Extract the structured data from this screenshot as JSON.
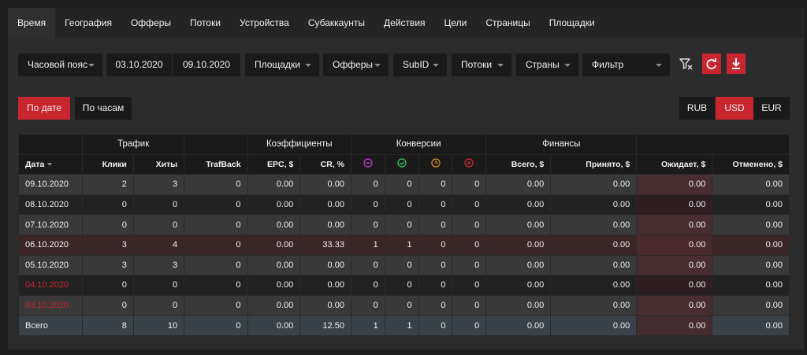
{
  "tabs": [
    "Время",
    "География",
    "Офферы",
    "Потоки",
    "Устройства",
    "Субаккаунты",
    "Действия",
    "Цели",
    "Страницы",
    "Площадки"
  ],
  "filters": {
    "timezone": "Часовой пояс",
    "date_from": "03.10.2020",
    "date_to": "09.10.2020",
    "platforms": "Площадки",
    "offers": "Офферы",
    "subid": "SubID",
    "streams": "Потоки",
    "countries": "Страны",
    "filter": "Фильтр"
  },
  "icons": {
    "filter_clear": "filter-clear-icon",
    "refresh": "refresh-icon",
    "download": "download-icon"
  },
  "grouping": {
    "by_date": "По дате",
    "by_hour": "По часам"
  },
  "currency": {
    "rub": "RUB",
    "usd": "USD",
    "eur": "EUR",
    "selected": "USD"
  },
  "table": {
    "groups": {
      "traffic": "Трафик",
      "ratios": "Коэффициенты",
      "conversions": "Конверсии",
      "finance": "Финансы"
    },
    "columns": {
      "date": "Дата",
      "clicks": "Клики",
      "hits": "Хиты",
      "trafback": "TrafBack",
      "epc": "EPC, $",
      "cr": "CR, %",
      "total": "Всего, $",
      "accepted": "Принято, $",
      "pending": "Ожидает, $",
      "cancelled": "Отменено, $"
    },
    "conversion_icons": [
      {
        "name": "pending-conversion-icon",
        "color": "#c13bd0"
      },
      {
        "name": "approved-conversion-icon",
        "color": "#3fc45a"
      },
      {
        "name": "hold-conversion-icon",
        "color": "#e08a1e"
      },
      {
        "name": "rejected-conversion-icon",
        "color": "#c8252f"
      }
    ],
    "rows": [
      {
        "date": "09.10.2020",
        "weekend": false,
        "clicks": "2",
        "hits": "3",
        "trafback": "0",
        "epc": "0.00",
        "cr": "0.00",
        "c1": "0",
        "c2": "0",
        "c3": "0",
        "c4": "0",
        "total": "0.00",
        "accepted": "0.00",
        "pending": "0.00",
        "cancelled": "0.00"
      },
      {
        "date": "08.10.2020",
        "weekend": false,
        "clicks": "0",
        "hits": "0",
        "trafback": "0",
        "epc": "0.00",
        "cr": "0.00",
        "c1": "0",
        "c2": "0",
        "c3": "0",
        "c4": "0",
        "total": "0.00",
        "accepted": "0.00",
        "pending": "0.00",
        "cancelled": "0.00"
      },
      {
        "date": "07.10.2020",
        "weekend": false,
        "clicks": "0",
        "hits": "0",
        "trafback": "0",
        "epc": "0.00",
        "cr": "0.00",
        "c1": "0",
        "c2": "0",
        "c3": "0",
        "c4": "0",
        "total": "0.00",
        "accepted": "0.00",
        "pending": "0.00",
        "cancelled": "0.00"
      },
      {
        "date": "06.10.2020",
        "weekend": false,
        "highlight": true,
        "clicks": "3",
        "hits": "4",
        "trafback": "0",
        "epc": "0.00",
        "cr": "33.33",
        "c1": "1",
        "c2": "1",
        "c3": "0",
        "c4": "0",
        "total": "0.00",
        "accepted": "0.00",
        "pending": "0.00",
        "cancelled": "0.00"
      },
      {
        "date": "05.10.2020",
        "weekend": false,
        "clicks": "3",
        "hits": "3",
        "trafback": "0",
        "epc": "0.00",
        "cr": "0.00",
        "c1": "0",
        "c2": "0",
        "c3": "0",
        "c4": "0",
        "total": "0.00",
        "accepted": "0.00",
        "pending": "0.00",
        "cancelled": "0.00"
      },
      {
        "date": "04.10.2020",
        "weekend": true,
        "clicks": "0",
        "hits": "0",
        "trafback": "0",
        "epc": "0.00",
        "cr": "0.00",
        "c1": "0",
        "c2": "0",
        "c3": "0",
        "c4": "0",
        "total": "0.00",
        "accepted": "0.00",
        "pending": "0.00",
        "cancelled": "0.00"
      },
      {
        "date": "03.10.2020",
        "weekend": true,
        "clicks": "0",
        "hits": "0",
        "trafback": "0",
        "epc": "0.00",
        "cr": "0.00",
        "c1": "0",
        "c2": "0",
        "c3": "0",
        "c4": "0",
        "total": "0.00",
        "accepted": "0.00",
        "pending": "0.00",
        "cancelled": "0.00"
      }
    ],
    "totals": {
      "date": "Всего",
      "clicks": "8",
      "hits": "10",
      "trafback": "0",
      "epc": "0.00",
      "cr": "12.50",
      "c1": "1",
      "c2": "1",
      "c3": "0",
      "c4": "0",
      "total": "0.00",
      "accepted": "0.00",
      "pending": "0.00",
      "cancelled": "0.00"
    }
  },
  "colors": {
    "accent": "#c8252f",
    "background": "#1e1e1e",
    "panel": "#2c2c2c"
  }
}
